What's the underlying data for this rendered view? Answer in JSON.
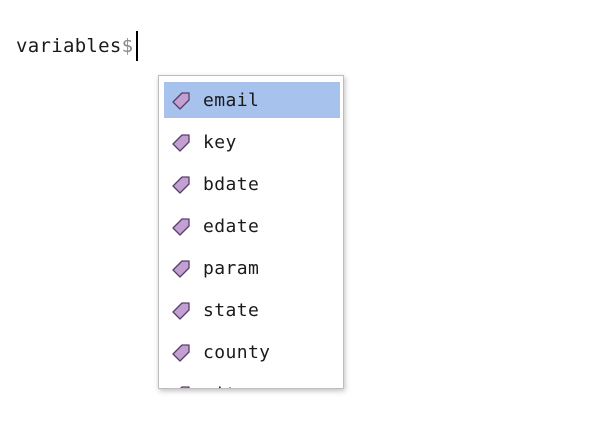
{
  "editor": {
    "line_text": "variables",
    "sigil": "$"
  },
  "autocomplete": {
    "icon": "property-tag-icon",
    "icon_color": "#c3a0d2",
    "selected_color": "#a6c2ed",
    "items": [
      {
        "label": "email",
        "selected": true
      },
      {
        "label": "key",
        "selected": false
      },
      {
        "label": "bdate",
        "selected": false
      },
      {
        "label": "edate",
        "selected": false
      },
      {
        "label": "param",
        "selected": false
      },
      {
        "label": "state",
        "selected": false
      },
      {
        "label": "county",
        "selected": false
      },
      {
        "label": "city",
        "selected": false
      }
    ]
  }
}
